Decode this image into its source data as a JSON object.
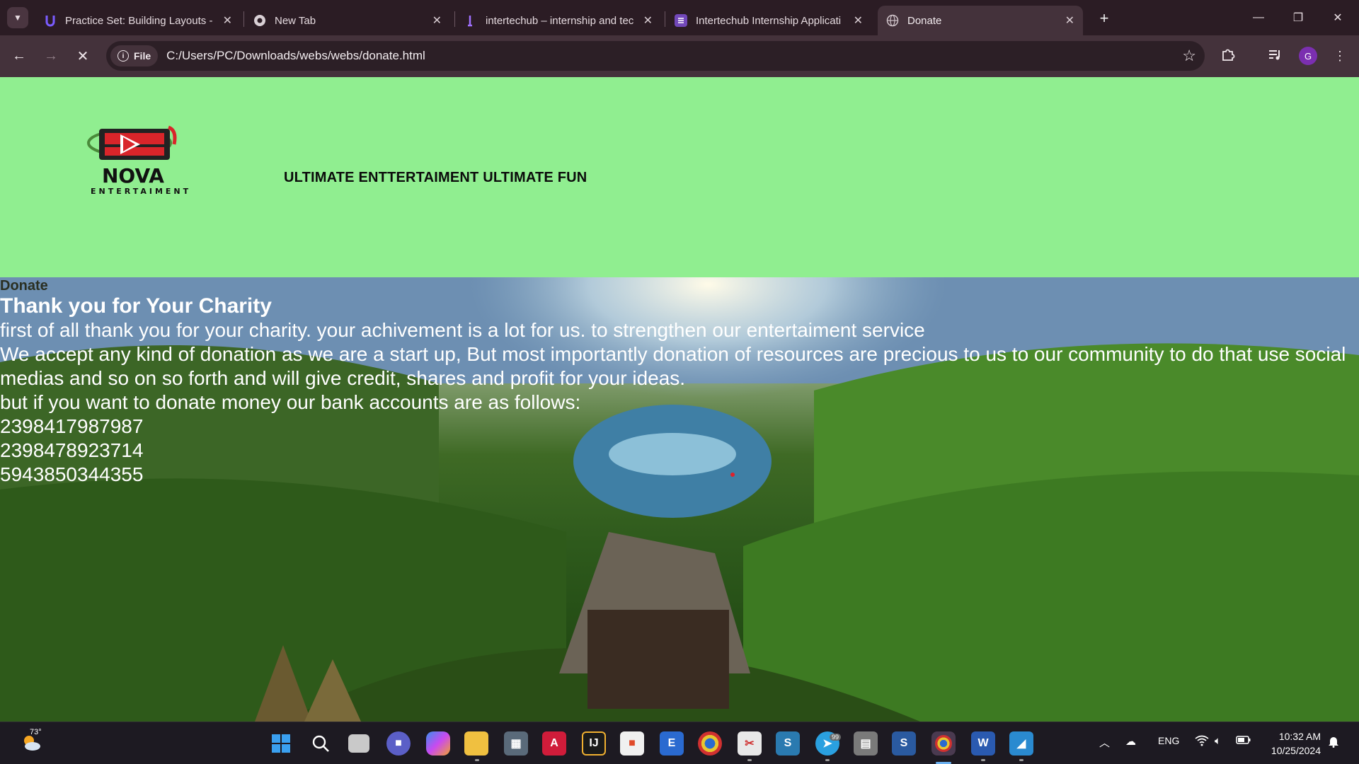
{
  "browser": {
    "tabs": [
      {
        "title": "Practice Set: Building Layouts -",
        "favicon": "udemy-icon",
        "active": false
      },
      {
        "title": "New Tab",
        "favicon": "chrome-icon",
        "active": false
      },
      {
        "title": "intertechub – internship and tec",
        "favicon": "intertechub-icon",
        "active": false
      },
      {
        "title": "Intertechub Internship Applicati",
        "favicon": "forms-icon",
        "active": false
      },
      {
        "title": "Donate",
        "favicon": "globe-icon",
        "active": true
      }
    ],
    "address": {
      "chip_label": "File",
      "url": "C:/Users/PC/Downloads/webs/webs/donate.html"
    },
    "profile_initial": "G"
  },
  "page": {
    "logo": {
      "brand": "NOVA",
      "sub": "ENTERTAIMENT"
    },
    "tagline": "ULTIMATE ENTTERTAIMENT ULTIMATE FUN",
    "donate_link": "Donate",
    "heading": "Thank you for Your Charity",
    "lines": [
      "first of all thank you for your charity. your achivement is a lot for us. to strengthen our entertaiment service",
      "We accept any kind of donation as we are a start up, But most importantly donation of resources are precious to us to our community to do that use social medias and so on so forth and will give credit, shares and profit for your ideas.",
      "but if you want to donate money our bank accounts are as follows:",
      "2398417987987",
      "2398478923714",
      "5943850344355"
    ]
  },
  "taskbar": {
    "weather_temp": "73°",
    "language": "ENG",
    "time": "10:32 AM",
    "date": "10/25/2024",
    "telegram_badge": "99"
  },
  "colors": {
    "header_bg": "#90ee90",
    "tab_strip": "#2b1c24",
    "toolbar": "#44323b"
  }
}
